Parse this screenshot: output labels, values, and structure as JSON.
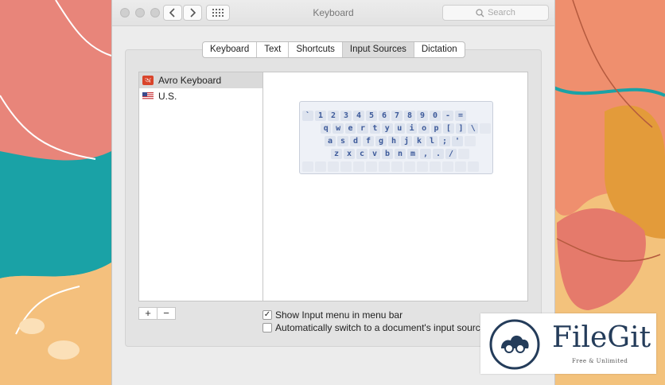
{
  "window": {
    "title": "Keyboard",
    "search_placeholder": "Search"
  },
  "tabs": [
    {
      "label": "Keyboard"
    },
    {
      "label": "Text"
    },
    {
      "label": "Shortcuts"
    },
    {
      "label": "Input Sources",
      "active": true
    },
    {
      "label": "Dictation"
    }
  ],
  "input_sources": [
    {
      "label": "Avro Keyboard",
      "selected": true
    },
    {
      "label": "U.S."
    }
  ],
  "keyboard_rows": [
    [
      "`",
      "1",
      "2",
      "3",
      "4",
      "5",
      "6",
      "7",
      "8",
      "9",
      "0",
      "-",
      "="
    ],
    [
      "q",
      "w",
      "e",
      "r",
      "t",
      "y",
      "u",
      "i",
      "o",
      "p",
      "[",
      "]",
      "\\"
    ],
    [
      "a",
      "s",
      "d",
      "f",
      "g",
      "h",
      "j",
      "k",
      "l",
      ";",
      "'"
    ],
    [
      "z",
      "x",
      "c",
      "v",
      "b",
      "n",
      "m",
      ",",
      ".",
      "/"
    ]
  ],
  "list_buttons": {
    "add": "+",
    "remove": "−"
  },
  "options": {
    "show_input_menu": {
      "label": "Show Input menu in menu bar",
      "checked": true
    },
    "auto_switch": {
      "label": "Automatically switch to a document's input source",
      "checked": false
    }
  },
  "watermark": {
    "name": "FileGit",
    "tagline": "Free & Unlimited"
  },
  "colors": {
    "accent_key": "#3d5a9a",
    "logo_navy": "#243c5a"
  }
}
